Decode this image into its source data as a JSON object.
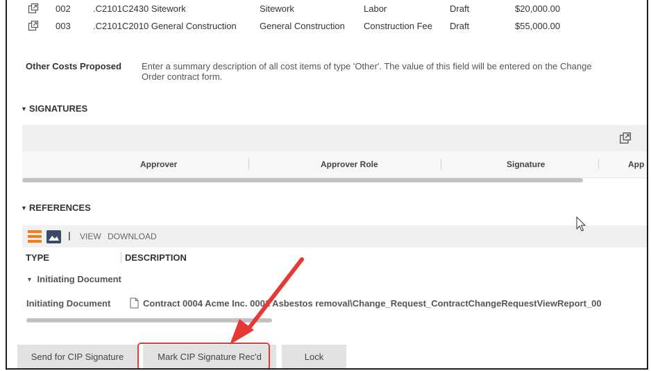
{
  "line_items": [
    {
      "number": "002",
      "code": ".C2101C2430 Sitework",
      "category": "Sitework",
      "type": "Labor",
      "status": "Draft",
      "amount": "$20,000.00"
    },
    {
      "number": "003",
      "code": ".C2101C2010 General Construction",
      "category": "General Construction",
      "type": "Construction Fee",
      "status": "Draft",
      "amount": "$55,000.00"
    }
  ],
  "other_costs": {
    "label": "Other Costs Proposed",
    "description_line1": "Enter a summary description of all cost items of type 'Other'.  The value of this field will be entered on the Change",
    "description_line2": "Order contract form."
  },
  "signatures": {
    "title": "SIGNATURES",
    "columns": [
      "Approver",
      "Approver Role",
      "Signature",
      "App"
    ]
  },
  "references": {
    "title": "REFERENCES",
    "toolbar": {
      "view": "VIEW",
      "download": "DOWNLOAD",
      "separator": "|"
    },
    "columns": [
      "TYPE",
      "DESCRIPTION"
    ],
    "group_title": "Initiating Document",
    "row_type": "Initiating Document",
    "row_description": "Contract 0004 Acme Inc. 0001 Asbestos removal\\Change_Request_ContractChangeRequestViewReport_00"
  },
  "buttons": {
    "send": "Send for CIP Signature",
    "mark": "Mark CIP Signature Rec'd",
    "lock": "Lock"
  },
  "colors": {
    "highlight": "#e53935",
    "list_icon": "#f07e1c",
    "image_icon": "#3a4a66"
  },
  "icons": [
    "open-link-icon",
    "list-view-icon",
    "image-view-icon",
    "document-icon",
    "chevron-down-icon",
    "mouse-cursor-icon",
    "arrow-annotation-icon"
  ]
}
